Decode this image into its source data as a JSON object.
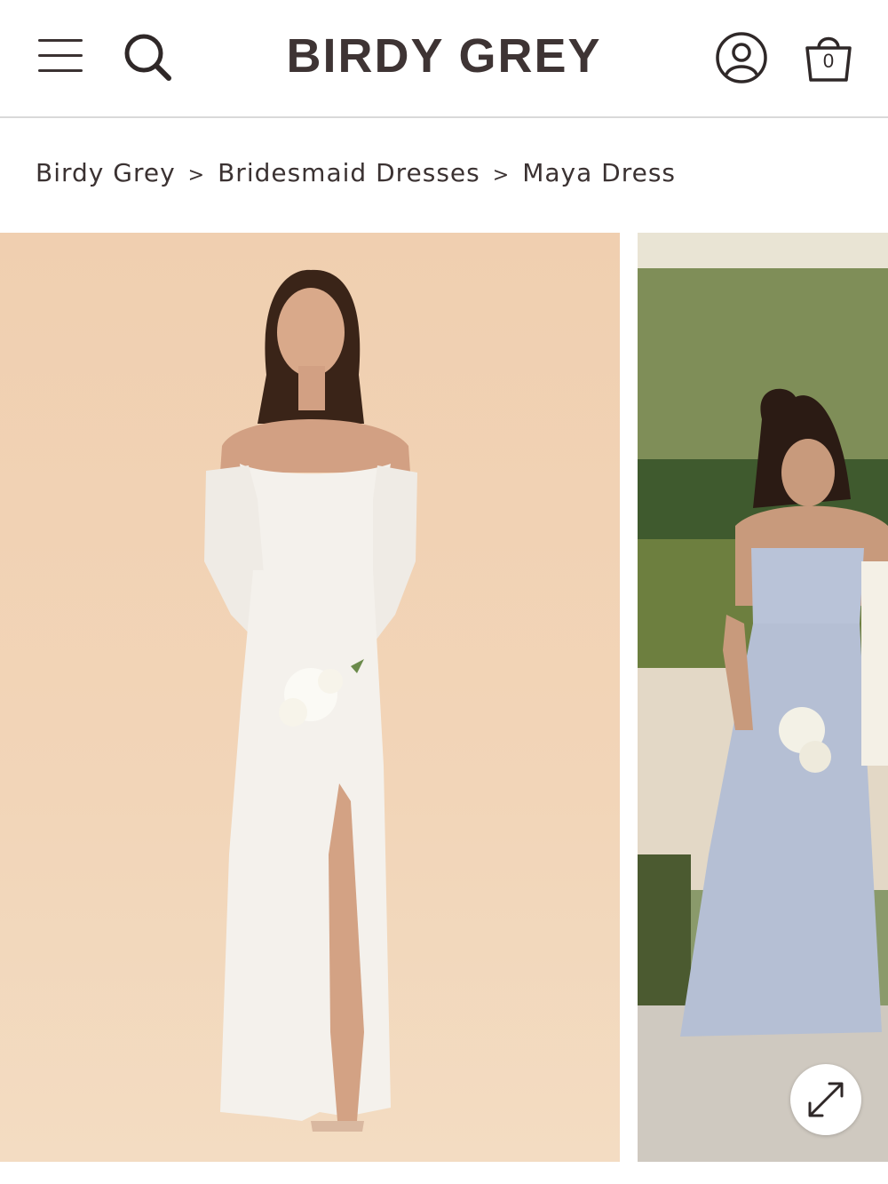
{
  "header": {
    "logo": "BIRDY GREY",
    "menu_icon": "hamburger-menu-icon",
    "search_icon": "search-icon",
    "account_icon": "user-account-icon",
    "cart_icon": "shopping-bag-icon",
    "cart_count": "0"
  },
  "breadcrumb": {
    "items": [
      "Birdy Grey",
      "Bridesmaid Dresses",
      "Maya Dress"
    ],
    "separator": ">"
  },
  "gallery": {
    "images": [
      {
        "alt": "Model in white off-shoulder satin dress holding bouquet",
        "background": "#f0cfb0",
        "dress_color": "#f4f1ec"
      },
      {
        "alt": "Model in light blue strapless chiffon dress in garden",
        "background": "#8a9a6b",
        "dress_color": "#b9c3d8"
      }
    ],
    "expand_icon": "expand-arrows-icon"
  },
  "colors": {
    "text": "#3b3232",
    "divider": "#d9d9d9"
  }
}
